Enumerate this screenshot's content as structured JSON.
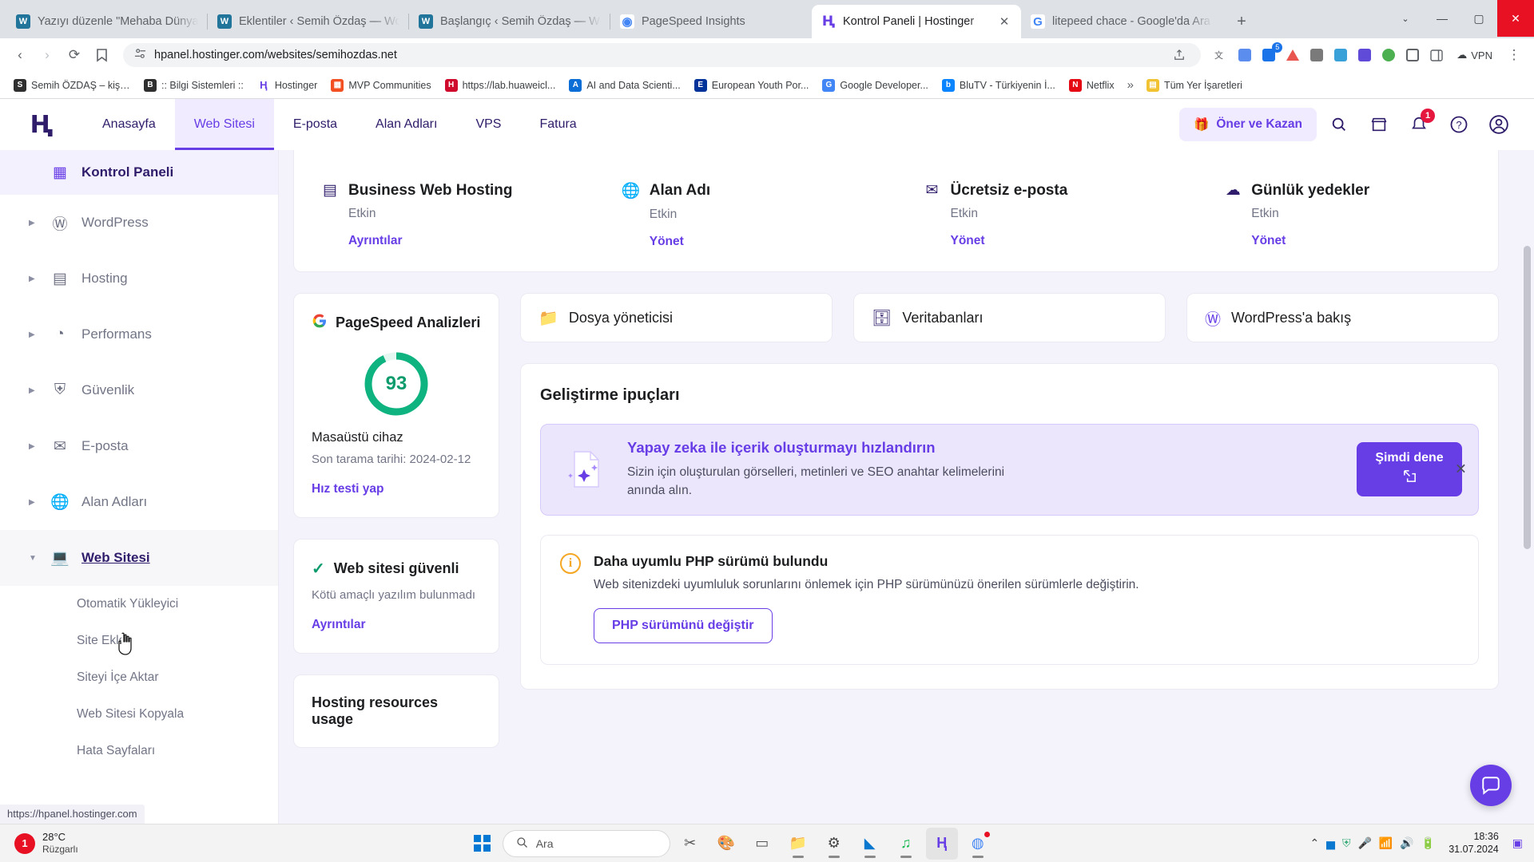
{
  "browser": {
    "tabs": [
      {
        "title": "Yazıyı düzenle \"Mehaba Dünya",
        "icon": "wordpress-icon",
        "active": false
      },
      {
        "title": "Eklentiler ‹ Semih Özdaş — Wo",
        "icon": "wordpress-icon",
        "active": false
      },
      {
        "title": "Başlangıç ‹ Semih Özdaş — Wo",
        "icon": "wordpress-icon",
        "active": false
      },
      {
        "title": "PageSpeed Insights",
        "icon": "pagespeed-icon",
        "active": false
      },
      {
        "title": "Kontrol Paneli | Hostinger",
        "icon": "hostinger-icon",
        "active": true
      },
      {
        "title": "litepeed chace - Google'da Ara",
        "icon": "google-icon",
        "active": false
      }
    ],
    "new_tab_label": "+",
    "window_controls": {
      "minimize": "—",
      "maximize": "▢",
      "close": "✕",
      "tab_search": "⌄"
    },
    "toolbar": {
      "back": "‹",
      "forward": "›",
      "reload": "⟳",
      "bookmark_star": "bookmark-icon",
      "url": "hpanel.hostinger.com/websites/semihozdas.net",
      "site_info": "site-settings-icon",
      "share": "share-icon",
      "vpn_label": "VPN",
      "notification_count": "5",
      "menu": "⋮"
    },
    "bookmarks": [
      {
        "label": "Semih ÖZDAŞ – kişi...",
        "color": "#2f2f2f"
      },
      {
        "label": ":: Bilgi Sistemleri ::",
        "color": "#2f2f2f"
      },
      {
        "label": "Hostinger",
        "color": "#673de6"
      },
      {
        "label": "MVP Communities",
        "color": "#f25022"
      },
      {
        "label": "https://lab.huaweicl...",
        "color": "#cf0a2c"
      },
      {
        "label": "AI and Data Scienti...",
        "color": "#0b6dd6"
      },
      {
        "label": "European Youth Por...",
        "color": "#003399"
      },
      {
        "label": "Google Developer...",
        "color": "#4285f4"
      },
      {
        "label": "BluTV - Türkiyenin İ...",
        "color": "#0a84ff"
      },
      {
        "label": "Netflix",
        "color": "#e50914"
      },
      {
        "label": "Tüm Yer İşaretleri",
        "color": "#f1c232"
      }
    ],
    "bookmarks_overflow": "»"
  },
  "hpanel": {
    "logo": "hostinger-logo",
    "nav": [
      {
        "label": "Anasayfa",
        "active": false
      },
      {
        "label": "Web Sitesi",
        "active": true
      },
      {
        "label": "E-posta",
        "active": false
      },
      {
        "label": "Alan Adları",
        "active": false
      },
      {
        "label": "VPS",
        "active": false
      },
      {
        "label": "Fatura",
        "active": false
      }
    ],
    "promo_button": "Öner ve Kazan",
    "promo_icon": "gift-icon",
    "actions": [
      {
        "name": "search-icon",
        "glyph": "🔍"
      },
      {
        "name": "store-icon",
        "glyph": "🏬"
      },
      {
        "name": "notifications-icon",
        "glyph": "🔔",
        "badge": "1"
      },
      {
        "name": "help-icon",
        "glyph": "?"
      },
      {
        "name": "account-icon",
        "glyph": "👤"
      }
    ]
  },
  "sidebar": {
    "items": [
      {
        "label": "Kontrol Paneli",
        "icon": "dashboard-icon",
        "state": "highlight",
        "expandable": false
      },
      {
        "label": "WordPress",
        "icon": "wordpress-icon",
        "state": "normal",
        "expandable": true
      },
      {
        "label": "Hosting",
        "icon": "server-icon",
        "state": "normal",
        "expandable": true
      },
      {
        "label": "Performans",
        "icon": "speed-icon",
        "state": "normal",
        "expandable": true
      },
      {
        "label": "Güvenlik",
        "icon": "shield-icon",
        "state": "normal",
        "expandable": true
      },
      {
        "label": "E-posta",
        "icon": "mail-icon",
        "state": "normal",
        "expandable": true
      },
      {
        "label": "Alan Adları",
        "icon": "globe-icon",
        "state": "normal",
        "expandable": true
      },
      {
        "label": "Web Sitesi",
        "icon": "laptop-icon",
        "state": "current",
        "expandable": true
      }
    ],
    "subitems": [
      "Otomatik Yükleyici",
      "Site Ekle",
      "Siteyi İçe Aktar",
      "Web Sitesi Kopyala",
      "Hata Sayfaları"
    ],
    "status_url": "https://hpanel.hostinger.com"
  },
  "main": {
    "services": [
      {
        "name": "Business Web Hosting",
        "status": "Etkin",
        "action": "Ayrıntılar",
        "icon": "server-icon"
      },
      {
        "name": "Alan Adı",
        "status": "Etkin",
        "action": "Yönet",
        "icon": "www-icon"
      },
      {
        "name": "Ücretsiz e-posta",
        "status": "Etkin",
        "action": "Yönet",
        "icon": "mail-icon"
      },
      {
        "name": "Günlük yedekler",
        "status": "Etkin",
        "action": "Yönet",
        "icon": "cloud-icon"
      }
    ],
    "quick_links": [
      {
        "label": "Dosya yöneticisi",
        "icon": "folder-icon",
        "color": "#673de6"
      },
      {
        "label": "Veritabanları",
        "icon": "database-icon",
        "color": "#2f1c6a"
      },
      {
        "label": "WordPress'a bakış",
        "icon": "wordpress-icon",
        "color": "#673de6"
      }
    ],
    "pagespeed": {
      "title": "PageSpeed Analizleri",
      "icon": "google-icon",
      "score": "93",
      "device": "Masaüstü cihaz",
      "last_scan": "Son tarama tarihi: 2024-02-12",
      "link": "Hız testi yap",
      "gauge_color": "#0eb37f"
    },
    "security": {
      "title": "Web sitesi güvenli",
      "subtitle": "Kötü amaçlı yazılım bulunmadı",
      "link": "Ayrıntılar",
      "icon": "check-icon"
    },
    "hosting_resources": {
      "title": "Hosting resources usage"
    },
    "tips": {
      "title": "Geliştirme ipuçları",
      "ai_banner": {
        "heading": "Yapay zeka ile içerik oluşturmayı hızlandırın",
        "body": "Sizin için oluşturulan görselleri, metinleri ve SEO anahtar kelimelerini anında alın.",
        "cta": "Şimdi dene",
        "cta_icon": "external-link-icon",
        "close_icon": "close-icon",
        "art_icon": "ai-document-icon"
      },
      "php_notice": {
        "icon": "info-icon",
        "heading": "Daha uyumlu PHP sürümü bulundu",
        "body": "Web sitenizdeki uyumluluk sorunlarını önlemek için PHP sürümünüzü önerilen sürümlerle değiştirin.",
        "button": "PHP sürümünü değiştir"
      }
    },
    "chat_icon": "chat-bubble-icon"
  },
  "taskbar": {
    "weather": {
      "temp": "28°C",
      "desc": "Rüzgarlı",
      "badge": "1"
    },
    "search_placeholder": "Ara",
    "search_icon": "search-icon",
    "start_icon": "windows-start-icon",
    "apps": [
      {
        "name": "snip-tool-icon",
        "glyph": "✂"
      },
      {
        "name": "paint-icon",
        "glyph": "🎨"
      },
      {
        "name": "task-view-icon",
        "glyph": "▭"
      },
      {
        "name": "file-explorer-icon",
        "glyph": "📁"
      },
      {
        "name": "settings-gear-icon",
        "glyph": "⚙"
      },
      {
        "name": "vscode-icon",
        "glyph": "◣"
      },
      {
        "name": "spotify-icon",
        "glyph": "♫"
      },
      {
        "name": "hostinger-browser-icon",
        "glyph": "H"
      },
      {
        "name": "chrome-icon",
        "glyph": "◍"
      }
    ],
    "tray": [
      {
        "name": "show-hidden-icons",
        "glyph": "⌃"
      },
      {
        "name": "stats-icon",
        "glyph": "📊"
      },
      {
        "name": "shield-tray-icon",
        "glyph": "🛡"
      },
      {
        "name": "mic-icon",
        "glyph": "🎤"
      },
      {
        "name": "wifi-icon",
        "glyph": "📶"
      },
      {
        "name": "volume-icon",
        "glyph": "🔊"
      },
      {
        "name": "battery-icon",
        "glyph": "🔋"
      }
    ],
    "clock": {
      "time": "18:36",
      "date": "31.07.2024"
    },
    "notification_icon": "action-center-icon"
  }
}
